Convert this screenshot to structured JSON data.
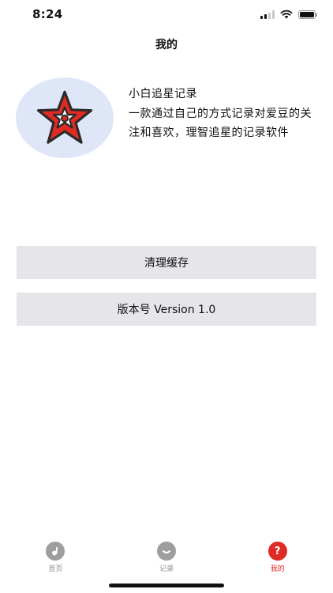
{
  "status_bar": {
    "time": "8:24"
  },
  "nav": {
    "title": "我的"
  },
  "profile": {
    "app_name": "小白追星记录",
    "description": "一款通过自己的方式记录对爱豆的关注和喜欢，理智追星的记录软件",
    "logo_icon": "star-logo-icon"
  },
  "actions": {
    "clear_cache_label": "清理缓存",
    "version_label": "版本号 Version 1.0"
  },
  "tab_bar": {
    "tabs": [
      {
        "label": "首页",
        "icon": "music-note-icon",
        "active": false
      },
      {
        "label": "记录",
        "icon": "chat-bubble-icon",
        "active": false
      },
      {
        "label": "我的",
        "icon": "question-icon",
        "active": true
      }
    ]
  },
  "colors": {
    "accent": "#e02a24",
    "row_background": "#e6e6ea",
    "avatar_background": "#dfe6f7",
    "tab_inactive": "#9e9e9e"
  }
}
